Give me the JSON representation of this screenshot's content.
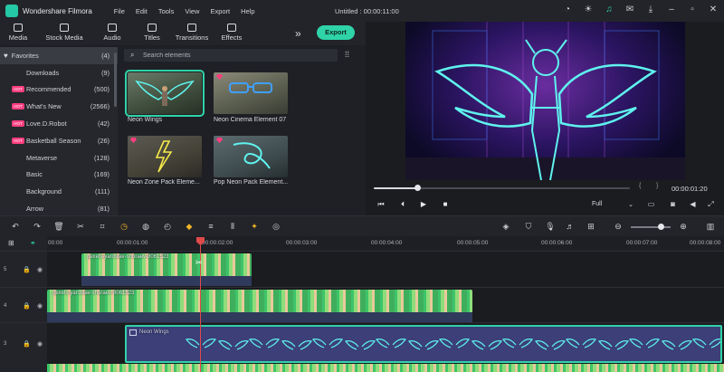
{
  "app": {
    "name": "Wondershare Filmora",
    "document_title": "Untitled : 00:00:11:00",
    "menus": [
      "File",
      "Edit",
      "Tools",
      "View",
      "Export",
      "Help"
    ]
  },
  "media_tabs": [
    "Media",
    "Stock Media",
    "Audio",
    "Titles",
    "Transitions",
    "Effects"
  ],
  "export_label": "Export",
  "sidebar": {
    "items": [
      {
        "label": "Favorites",
        "count": "(4)"
      },
      {
        "label": "Downloads",
        "count": "(9)"
      },
      {
        "label": "Recommended",
        "count": "(500)",
        "badge": "HOT"
      },
      {
        "label": "What's New",
        "count": "(2566)",
        "badge": "HOT"
      },
      {
        "label": "Love.D.Robot",
        "count": "(42)",
        "badge": "HOT"
      },
      {
        "label": "Basketball Season",
        "count": "(26)",
        "badge": "HOT"
      },
      {
        "label": "Metaverse",
        "count": "(128)"
      },
      {
        "label": "Basic",
        "count": "(169)"
      },
      {
        "label": "Background",
        "count": "(111)"
      },
      {
        "label": "Arrow",
        "count": "(81)"
      }
    ]
  },
  "search": {
    "placeholder": "Search elements"
  },
  "elements": [
    {
      "caption": "Neon Wings",
      "selected": true
    },
    {
      "caption": "Neon Cinema Element 07"
    },
    {
      "caption": "Neon Zone Pack Eleme..."
    },
    {
      "caption": "Pop Neon Pack Element..."
    }
  ],
  "player": {
    "timecode": "00:00:01:20",
    "quality": "Full",
    "progress_percent": 17
  },
  "ruler": {
    "labels": [
      "00:00",
      "00:00:01:00",
      "00:00:02:00",
      "00:00:03:00",
      "00:00:04:00",
      "00:00:05:00",
      "00:00:06:00",
      "00:00:07:00",
      "00:00:08:00"
    ]
  },
  "tracks": [
    {
      "number": "5",
      "clip": "pexels-yaroslav-shuraev-8061523"
    },
    {
      "number": "4",
      "clip": "pexels-yaroslav-shuraev-8061523"
    },
    {
      "number": "3",
      "clip": "Neon Wings"
    }
  ],
  "colors": {
    "accent": "#2fd3a8",
    "playhead": "#e04a4a",
    "hot_badge": "#ff3e7f"
  }
}
